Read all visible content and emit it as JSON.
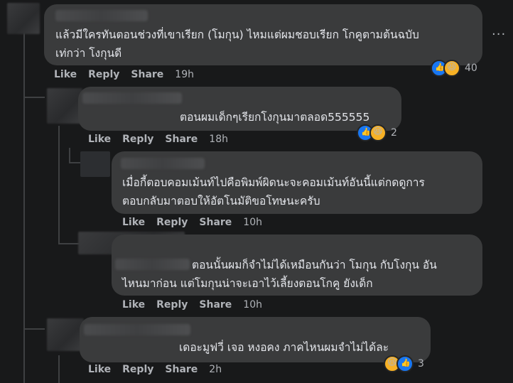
{
  "comments": [
    {
      "text_line1": "แล้วมีใครทันตอนช่วงที่เขาเรียก (โมกุน) ไหมแต่ผมชอบเรียก โกคูตามต้นฉบับ",
      "text_line2": "เท่กว่า โงกุนดี",
      "like": "Like",
      "reply": "Share",
      "reply_label": "Reply",
      "time": "19h",
      "reaction_count": "40"
    },
    {
      "text_line1": "ตอนผมเด็กๆเรียกโงกุนมาตลอด555555",
      "like": "Like",
      "reply_label": "Reply",
      "share": "Share",
      "time": "18h",
      "reaction_count": "2"
    },
    {
      "text_line1": "เมื่อกี้ตอบคอมเม้นท์ไปคือพิมพ์ผิดนะจะคอมเม้นท์อันนี้แต่กดดูการ",
      "text_line2": "ตอบกลับมาตอบให้อัตโนมัติขอโทษนะครับ",
      "like": "Like",
      "reply_label": "Reply",
      "share": "Share",
      "time": "10h"
    },
    {
      "text_line1": "ตอนนั้นผมก็จำไม่ได้เหมือนกันว่า โมกุน กับโงกุน อัน",
      "text_line2": "ไหนมาก่อน แต่โมกุนน่าจะเอาไว้เลี้ยงตอนโกคู ยังเด็ก",
      "like": "Like",
      "reply_label": "Reply",
      "share": "Share",
      "time": "10h"
    },
    {
      "text_line1": "เดอะมูฟวี่ เจอ หงอคง ภาคไหนผมจำไม่ได้ละ",
      "like": "Like",
      "reply_label": "Reply",
      "share": "Share",
      "time": "2h",
      "reaction_count": "3"
    }
  ],
  "more_options": "···",
  "icons": [
    "like-reaction-icon",
    "haha-reaction-icon",
    "more-options-icon"
  ]
}
